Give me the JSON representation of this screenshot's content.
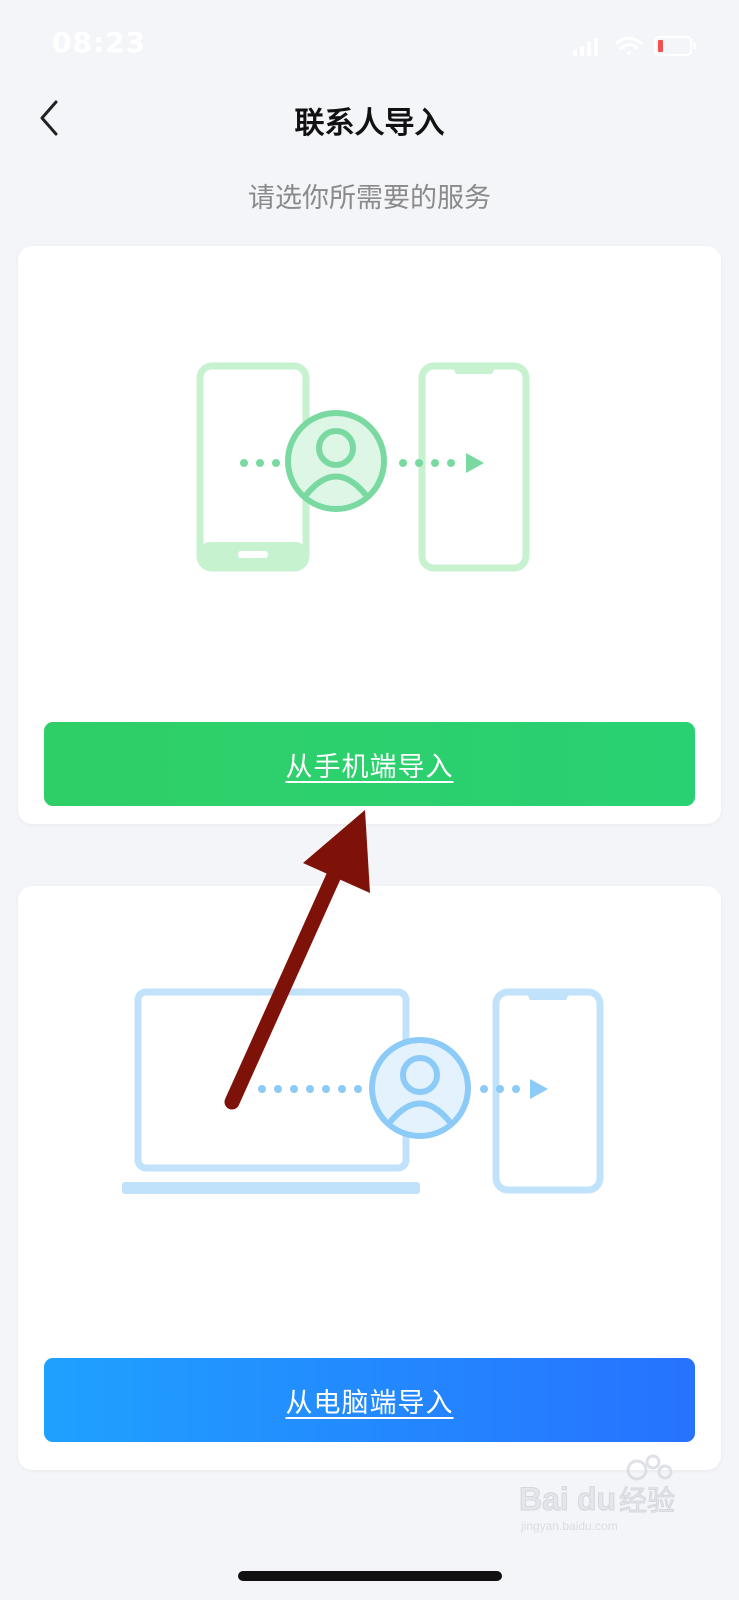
{
  "status_bar": {
    "time": "08:23"
  },
  "nav": {
    "title": "联系人导入",
    "back_icon": "chevron-left-icon"
  },
  "subtitle": "请选你所需要的服务",
  "cards": [
    {
      "illustration": "phone-to-phone-illustration",
      "button_label": "从手机端导入",
      "accent": "#2dcf6c"
    },
    {
      "illustration": "computer-to-phone-illustration",
      "button_label": "从电脑端导入",
      "accent": "#2484ff"
    }
  ],
  "watermark": {
    "brand": "Baidu经验",
    "url": "jingyan.baidu.com"
  },
  "colors": {
    "background": "#f4f5f8",
    "green_illustration": "#c6f2cf",
    "blue_illustration": "#c1e2fb",
    "annotation_arrow": "#7e1208"
  }
}
